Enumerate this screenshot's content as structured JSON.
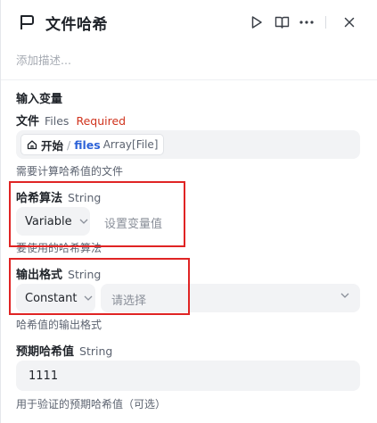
{
  "header": {
    "title": "文件哈希",
    "description_placeholder": "添加描述..."
  },
  "inputs": {
    "section_title": "输入变量",
    "file": {
      "label": "文件",
      "type": "Files",
      "required": "Required",
      "chip_source": "开始",
      "chip_separator": "/",
      "chip_var": "files",
      "chip_type": "Array[File]",
      "hint": "需要计算哈希值的文件"
    },
    "algorithm": {
      "label": "哈希算法",
      "type": "String",
      "mode": "Variable",
      "placeholder": "设置变量值",
      "hint": "要使用的哈希算法"
    },
    "output_format": {
      "label": "输出格式",
      "type": "String",
      "mode": "Constant",
      "placeholder": "请选择",
      "hint": "哈希值的输出格式"
    },
    "expected_hash": {
      "label": "预期哈希值",
      "type": "String",
      "value": "1111",
      "hint": "用于验证的预期哈希值（可选）"
    }
  },
  "icons": {
    "node": "flag-icon",
    "run": "play-icon",
    "docs": "book-icon",
    "more": "more-icon",
    "close": "close-icon",
    "home": "home-icon",
    "caret": "chevron-down-icon"
  },
  "colors": {
    "required": "#d0331d",
    "variable": "#2e63d8",
    "annotation": "#e02424"
  }
}
